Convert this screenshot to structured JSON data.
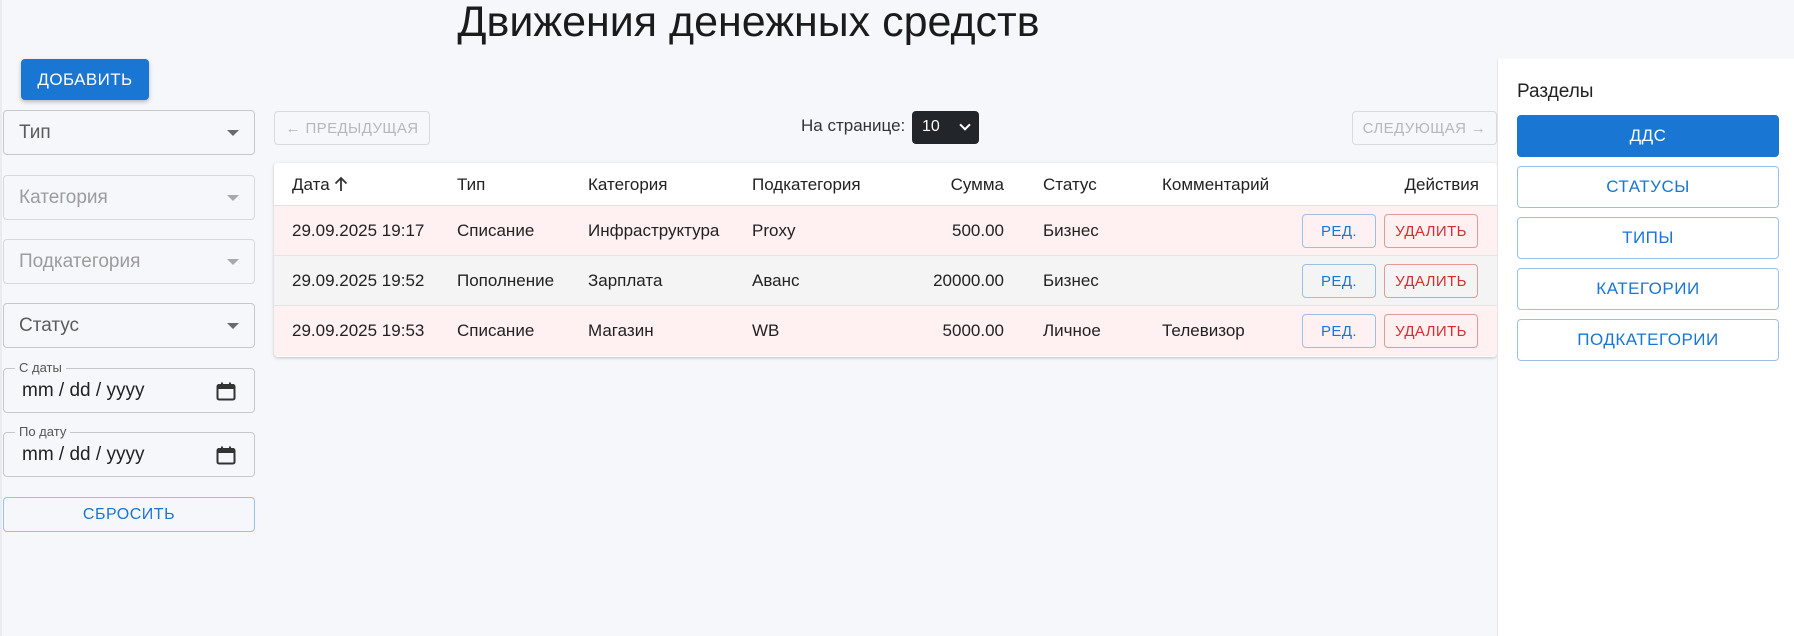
{
  "page": {
    "title": "Движения денежных средств"
  },
  "toolbar": {
    "add_label": "ДОБАВИТЬ"
  },
  "filters": {
    "type_label": "Тип",
    "category_label": "Категория",
    "subcategory_label": "Подкатегория",
    "status_label": "Статус",
    "date_from_label": "С даты",
    "date_from_value": "mm / dd / yyyy",
    "date_to_label": "По дату",
    "date_to_value": "mm / dd / yyyy",
    "reset_label": "СБРОСИТЬ"
  },
  "pagination": {
    "prev_label": "← ПРЕДЫДУЩАЯ",
    "next_label": "СЛЕДУЮЩАЯ →",
    "per_page_label": "На странице:",
    "per_page_value": "10"
  },
  "table": {
    "columns": [
      "Дата",
      "Тип",
      "Категория",
      "Подкатегория",
      "Сумма",
      "Статус",
      "Комментарий",
      "Действия"
    ],
    "rows": [
      {
        "date": "29.09.2025 19:17",
        "type": "Списание",
        "category": "Инфраструктура",
        "subcategory": "Proxy",
        "amount": "500.00",
        "status": "Бизнес",
        "comment": "",
        "edit": "РЕД.",
        "delete": "УДАЛИТЬ"
      },
      {
        "date": "29.09.2025 19:52",
        "type": "Пополнение",
        "category": "Зарплата",
        "subcategory": "Аванс",
        "amount": "20000.00",
        "status": "Бизнес",
        "comment": "",
        "edit": "РЕД.",
        "delete": "УДАЛИТЬ"
      },
      {
        "date": "29.09.2025 19:53",
        "type": "Списание",
        "category": "Магазин",
        "subcategory": "WB",
        "amount": "5000.00",
        "status": "Личное",
        "comment": "Телевизор",
        "edit": "РЕД.",
        "delete": "УДАЛИТЬ"
      }
    ]
  },
  "sidebar": {
    "title": "Разделы",
    "items": [
      {
        "label": "ДДС",
        "active": true
      },
      {
        "label": "СТАТУСЫ",
        "active": false
      },
      {
        "label": "ТИПЫ",
        "active": false
      },
      {
        "label": "КАТЕГОРИИ",
        "active": false
      },
      {
        "label": "ПОДКАТЕГОРИИ",
        "active": false
      }
    ]
  },
  "colors": {
    "accent": "#1976d2",
    "danger": "#d32f2f",
    "row_pink": "#fff0f1",
    "row_grey": "#f4f4f4"
  }
}
